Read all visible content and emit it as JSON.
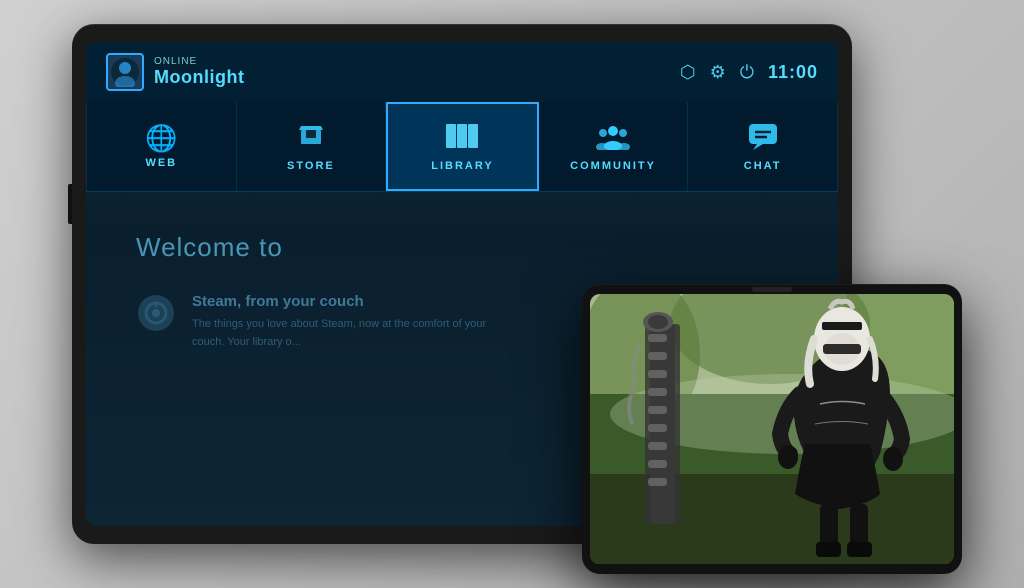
{
  "tablet": {
    "header": {
      "online_label": "Online",
      "username": "Moonlight",
      "time": "11:00"
    },
    "nav": {
      "tabs": [
        {
          "id": "web",
          "label": "WEB",
          "icon": "🌐",
          "active": false
        },
        {
          "id": "store",
          "label": "STORE",
          "icon": "🛒",
          "active": false
        },
        {
          "id": "library",
          "label": "LIBRARY",
          "icon": "▦",
          "active": true
        },
        {
          "id": "community",
          "label": "COMMUNITY",
          "icon": "👥",
          "active": false
        },
        {
          "id": "chat",
          "label": "CHAT",
          "icon": "💬",
          "active": false
        }
      ]
    },
    "content": {
      "welcome": "Welcome to",
      "steam_tagline": "Steam, from your couch",
      "steam_description": "The things you love about Steam, now at the comfort of your couch. Your library o..."
    }
  }
}
